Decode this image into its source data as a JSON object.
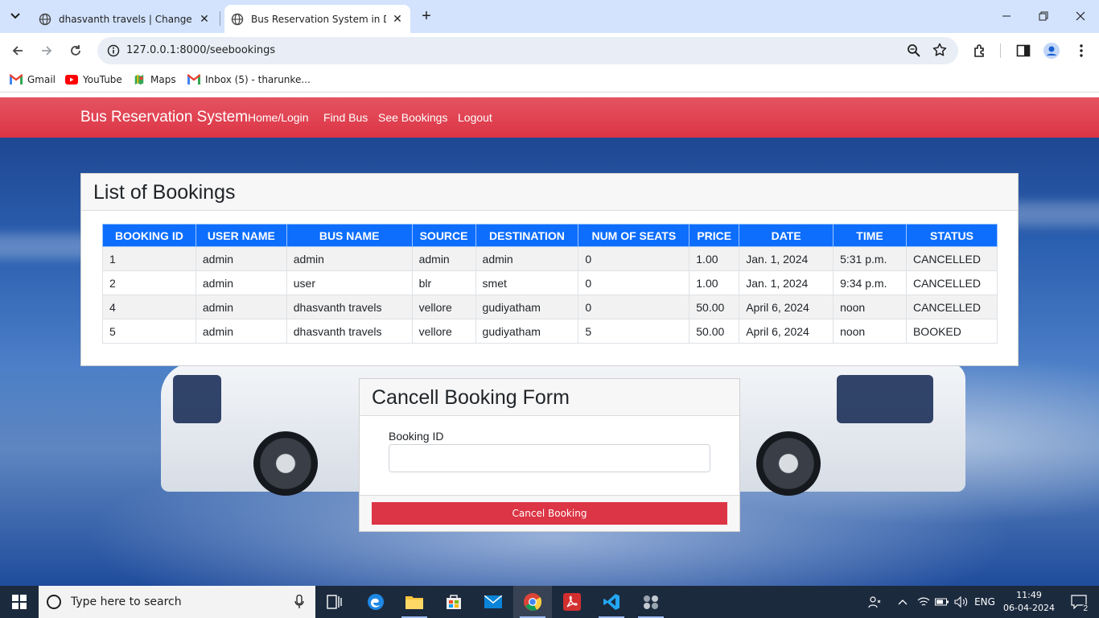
{
  "browser": {
    "tabs": [
      {
        "title": "dhasvanth travels | Change bus",
        "active": false
      },
      {
        "title": "Bus Reservation System in Djan",
        "active": true
      }
    ],
    "url": "127.0.0.1:8000/seebookings",
    "bookmarks": [
      {
        "label": "Gmail"
      },
      {
        "label": "YouTube"
      },
      {
        "label": "Maps"
      },
      {
        "label": "Inbox (5) - tharunke..."
      }
    ]
  },
  "navbar": {
    "brand": "Bus Reservation System",
    "links": [
      "Home/Login",
      "Find Bus",
      "See Bookings",
      "Logout"
    ]
  },
  "bookings": {
    "title": "List of Bookings",
    "columns": [
      "BOOKING ID",
      "USER NAME",
      "BUS NAME",
      "SOURCE",
      "DESTINATION",
      "NUM OF SEATS",
      "PRICE",
      "DATE",
      "TIME",
      "STATUS"
    ],
    "rows": [
      [
        "1",
        "admin",
        "admin",
        "admin",
        "admin",
        "0",
        "1.00",
        "Jan. 1, 2024",
        "5:31 p.m.",
        "CANCELLED"
      ],
      [
        "2",
        "admin",
        "user",
        "blr",
        "smet",
        "0",
        "1.00",
        "Jan. 1, 2024",
        "9:34 p.m.",
        "CANCELLED"
      ],
      [
        "4",
        "admin",
        "dhasvanth travels",
        "vellore",
        "gudiyatham",
        "0",
        "50.00",
        "April 6, 2024",
        "noon",
        "CANCELLED"
      ],
      [
        "5",
        "admin",
        "dhasvanth travels",
        "vellore",
        "gudiyatham",
        "5",
        "50.00",
        "April 6, 2024",
        "noon",
        "BOOKED"
      ]
    ]
  },
  "cancel_form": {
    "title": "Cancell Booking Form",
    "field_label": "Booking ID",
    "field_value": "",
    "submit_label": "Cancel Booking"
  },
  "taskbar": {
    "search_placeholder": "Type here to search",
    "language": "ENG",
    "time": "11:49",
    "date": "06-04-2024",
    "notification_count": "2"
  },
  "colors": {
    "navbar": "#dc3545",
    "table_header": "#0d6efd",
    "cancel_button": "#dc3545",
    "taskbar": "#1c2a3e"
  }
}
